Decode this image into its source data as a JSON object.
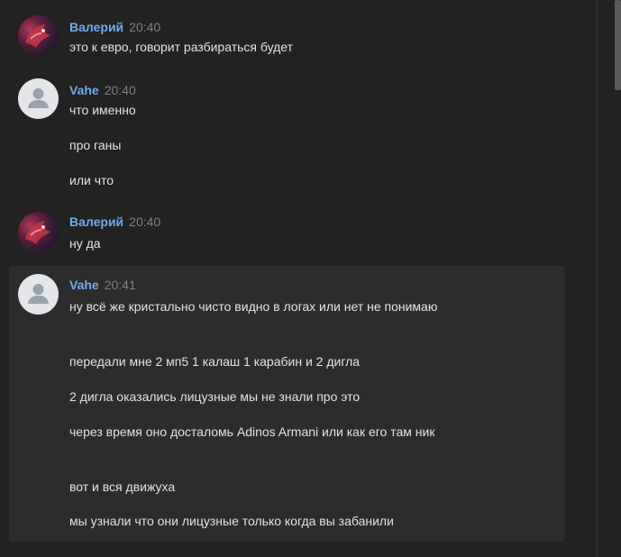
{
  "messages": [
    {
      "author": "Валерий",
      "time": "20:40",
      "avatar": "dragon-avatar",
      "lines": [
        "это к евро, говорит разбираться будет"
      ]
    },
    {
      "author": "Vahe",
      "time": "20:40",
      "avatar": "default-user-avatar",
      "lines": [
        "что именно",
        "про ганы",
        "или что"
      ]
    },
    {
      "author": "Валерий",
      "time": "20:40",
      "avatar": "dragon-avatar",
      "lines": [
        "ну да"
      ]
    },
    {
      "author": "Vahe",
      "time": "20:41",
      "avatar": "default-user-avatar",
      "highlighted": true,
      "lines": [
        "ну всё же кристально чисто видно в логах или нет не понимаю",
        "передали мне 2 мп5 1 калаш 1 карабин и 2 дигла",
        "2 дигла оказались лицузные мы не знали про это",
        "через время оно досталомь Adinos Armani или как его там ник",
        "вот и вся движуха",
        "мы узнали что они лицузные только когда вы забанили"
      ]
    }
  ],
  "colors": {
    "background": "#222222",
    "highlight": "#2c2c2c",
    "author": "#71aaeb",
    "time": "#828282",
    "text": "#e1e3e6"
  }
}
